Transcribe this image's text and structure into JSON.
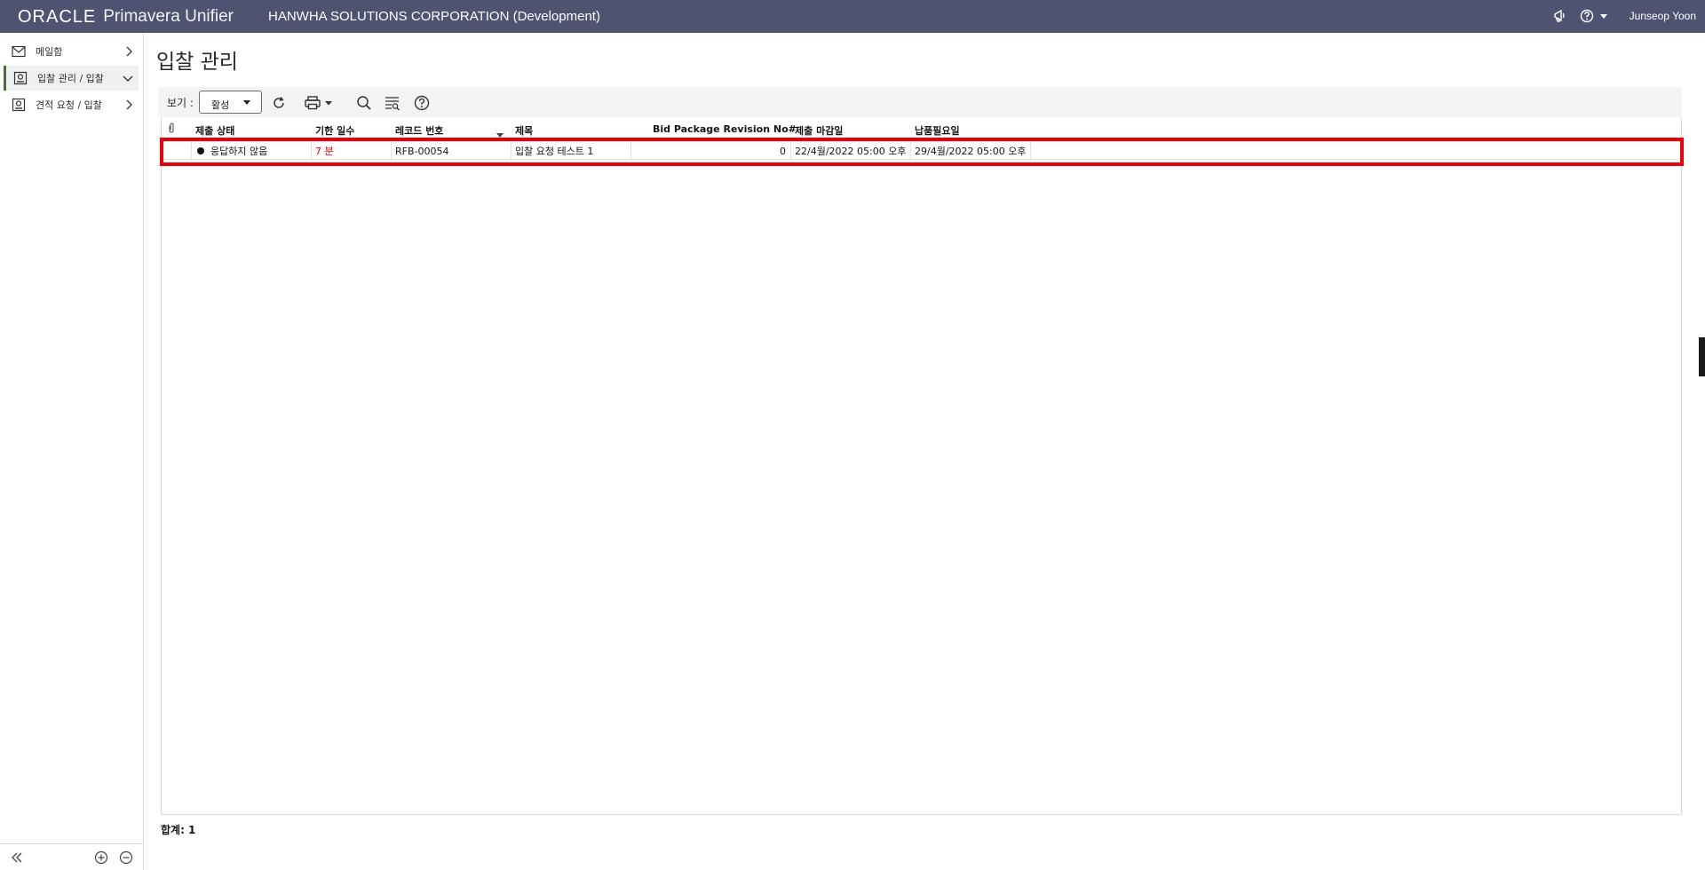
{
  "header": {
    "brand_oracle": "ORACLE",
    "brand_product": "Primavera Unifier",
    "company": "HANWHA SOLUTIONS CORPORATION (Development)",
    "user": "Junseop Yoon",
    "colors": {
      "bar": "#4f5371"
    }
  },
  "sidebar": {
    "items": [
      {
        "label": "메일함",
        "icon": "mail-icon"
      },
      {
        "label": "입찰 관리 / 입찰",
        "icon": "bid-icon"
      },
      {
        "label": "견적 요청 / 입찰",
        "icon": "quote-icon"
      }
    ]
  },
  "page": {
    "title": "입찰 관리"
  },
  "toolbar": {
    "view_label": "보기 :",
    "view_value": "활성"
  },
  "grid": {
    "columns": [
      "제출 상태",
      "기한 일수",
      "레코드 번호",
      "제목",
      "Bid Package Revision No#",
      "제출 마감일",
      "납품필요일"
    ],
    "rows": [
      {
        "status": "응답하지 않음",
        "days": "7 분",
        "record": "RFB-00054",
        "title": "입찰 요청 테스트 1",
        "revision": "0",
        "deadline": "22/4월/2022 05:00 오후",
        "delivery": "29/4월/2022 05:00 오후"
      }
    ]
  },
  "footer": {
    "total": "합계: 1"
  },
  "colors": {
    "accent_red": "#e8000b",
    "overdue": "#e8000b"
  }
}
